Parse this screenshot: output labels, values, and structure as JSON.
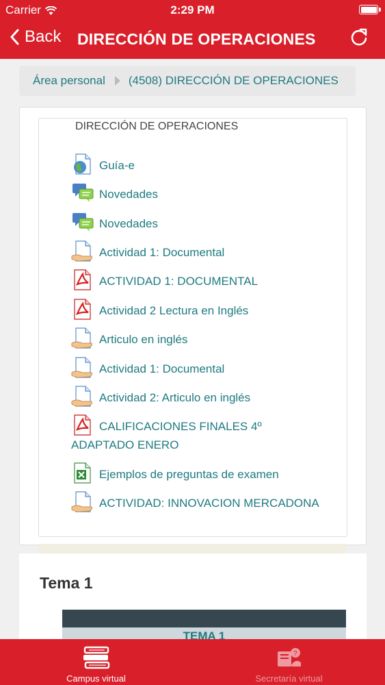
{
  "status_bar": {
    "carrier": "Carrier",
    "time": "2:29 PM"
  },
  "nav": {
    "back_label": "Back",
    "title": "DIRECCIÓN DE OPERACIONES"
  },
  "breadcrumb": {
    "home": "Área personal",
    "current": "(4508) DIRECCIÓN DE OPERACIONES"
  },
  "section": {
    "title": "DIRECCIÓN DE OPERACIONES",
    "items": [
      {
        "label": "Guía-e",
        "icon": "url-globe-icon"
      },
      {
        "label": "Novedades",
        "icon": "forum-icon"
      },
      {
        "label": "Novedades",
        "icon": "forum-icon"
      },
      {
        "label": "Actividad 1: Documental",
        "icon": "assignment-icon"
      },
      {
        "label": "ACTIVIDAD 1: DOCUMENTAL",
        "icon": "pdf-icon"
      },
      {
        "label": "Actividad 2 Lectura en Inglés",
        "icon": "pdf-icon"
      },
      {
        "label": "Articulo en inglés",
        "icon": "assignment-icon"
      },
      {
        "label": "Actividad 1: Documental",
        "icon": "assignment-icon"
      },
      {
        "label": "Actividad 2: Articulo en inglés",
        "icon": "assignment-icon"
      },
      {
        "label": "CALIFICACIONES FINALES 4º",
        "label_line2": "ADAPTADO ENERO",
        "icon": "pdf-icon"
      },
      {
        "label": "Ejemplos de preguntas de examen",
        "icon": "excel-icon"
      },
      {
        "label": "ACTIVIDAD: INNOVACION MERCADONA",
        "icon": "assignment-icon"
      }
    ]
  },
  "topic": {
    "title": "Tema 1",
    "banner": "TEMA 1"
  },
  "tabbar": {
    "tabs": [
      {
        "label": "Campus virtual",
        "icon": "books-icon",
        "active": true
      },
      {
        "label": "Secretaría virtual",
        "icon": "secretary-icon",
        "active": false
      }
    ]
  },
  "colors": {
    "brand_red": "#d81f2a",
    "link_teal": "#1f7a80"
  }
}
